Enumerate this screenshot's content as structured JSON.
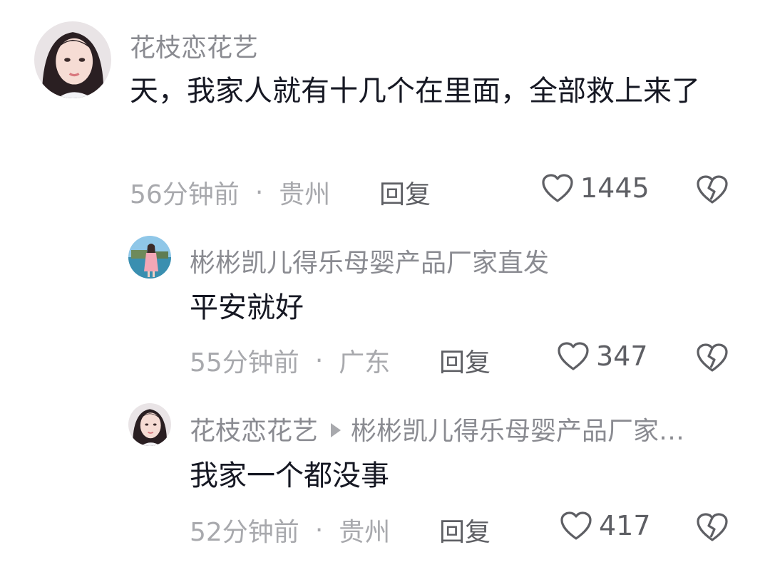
{
  "comments": [
    {
      "username": "花枝恋花艺",
      "text": "天，我家人就有十几个在里面，全部救上来了",
      "time": "56分钟前",
      "location": "贵州",
      "reply_label": "回复",
      "likes": "1445"
    },
    {
      "username": "彬彬凯儿得乐母婴产品厂家直发",
      "text": "平安就好",
      "time": "55分钟前",
      "location": "广东",
      "reply_label": "回复",
      "likes": "347"
    },
    {
      "username": "花枝恋花艺",
      "reply_to": "彬彬凯儿得乐母婴产品厂家…",
      "text": "我家一个都没事",
      "time": "52分钟前",
      "location": "贵州",
      "reply_label": "回复",
      "likes": "417"
    }
  ],
  "separator": "·",
  "icons": {
    "like": "heart-outline-icon",
    "dislike": "broken-heart-icon"
  },
  "colors": {
    "text": "#161823",
    "username": "#8a8b91",
    "meta": "#a8a9ad",
    "action": "#5e5f64"
  }
}
